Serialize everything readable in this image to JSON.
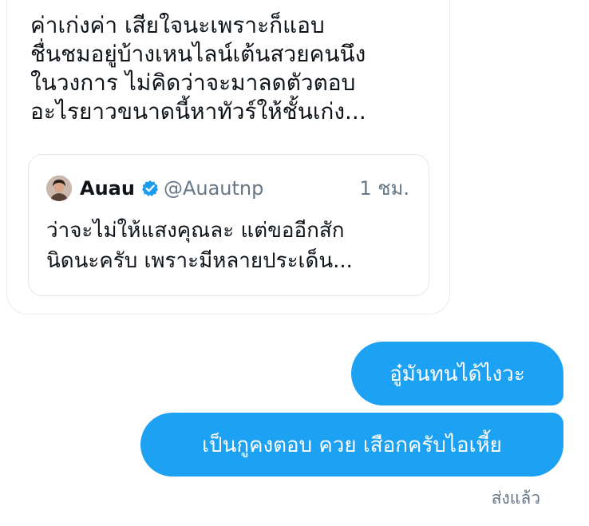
{
  "received_message": {
    "lines": [
      "ค่าเก่งค่า เสียใจนะเพราะก็แอบ",
      "ชื่นชมอยู่บ้างเหนไลน์เต้นสวยคนนึง",
      "ในวงการ ไม่คิดว่าจะมาลดตัวตอบ",
      "อะไรยาวขนาดนี้หาทัวร์ให้ชั้นเก่ง..."
    ]
  },
  "quoted_tweet": {
    "name": "Auau",
    "handle": "@Auautnp",
    "time": "1 ชม.",
    "lines": [
      "ว่าจะไม่ให้แสงคุณละ แต่ขออีกสัก",
      "นิดนะครับ เพราะมีหลายประเด็น..."
    ],
    "avatar_icon": "user-avatar",
    "verified_icon": "verified-badge-icon",
    "verified_color": "#1d9bf0"
  },
  "sent_messages": [
    {
      "text": "อู๋มันทนได้ไงวะ"
    },
    {
      "text": "เป็นกูคงตอบ ควย เสือกครับไอเหี้ย"
    }
  ],
  "sent_status": "ส่งแล้ว",
  "colors": {
    "sent_bubble": "#1da1f2",
    "secondary_text": "#657786",
    "border": "#e6ecf0"
  }
}
